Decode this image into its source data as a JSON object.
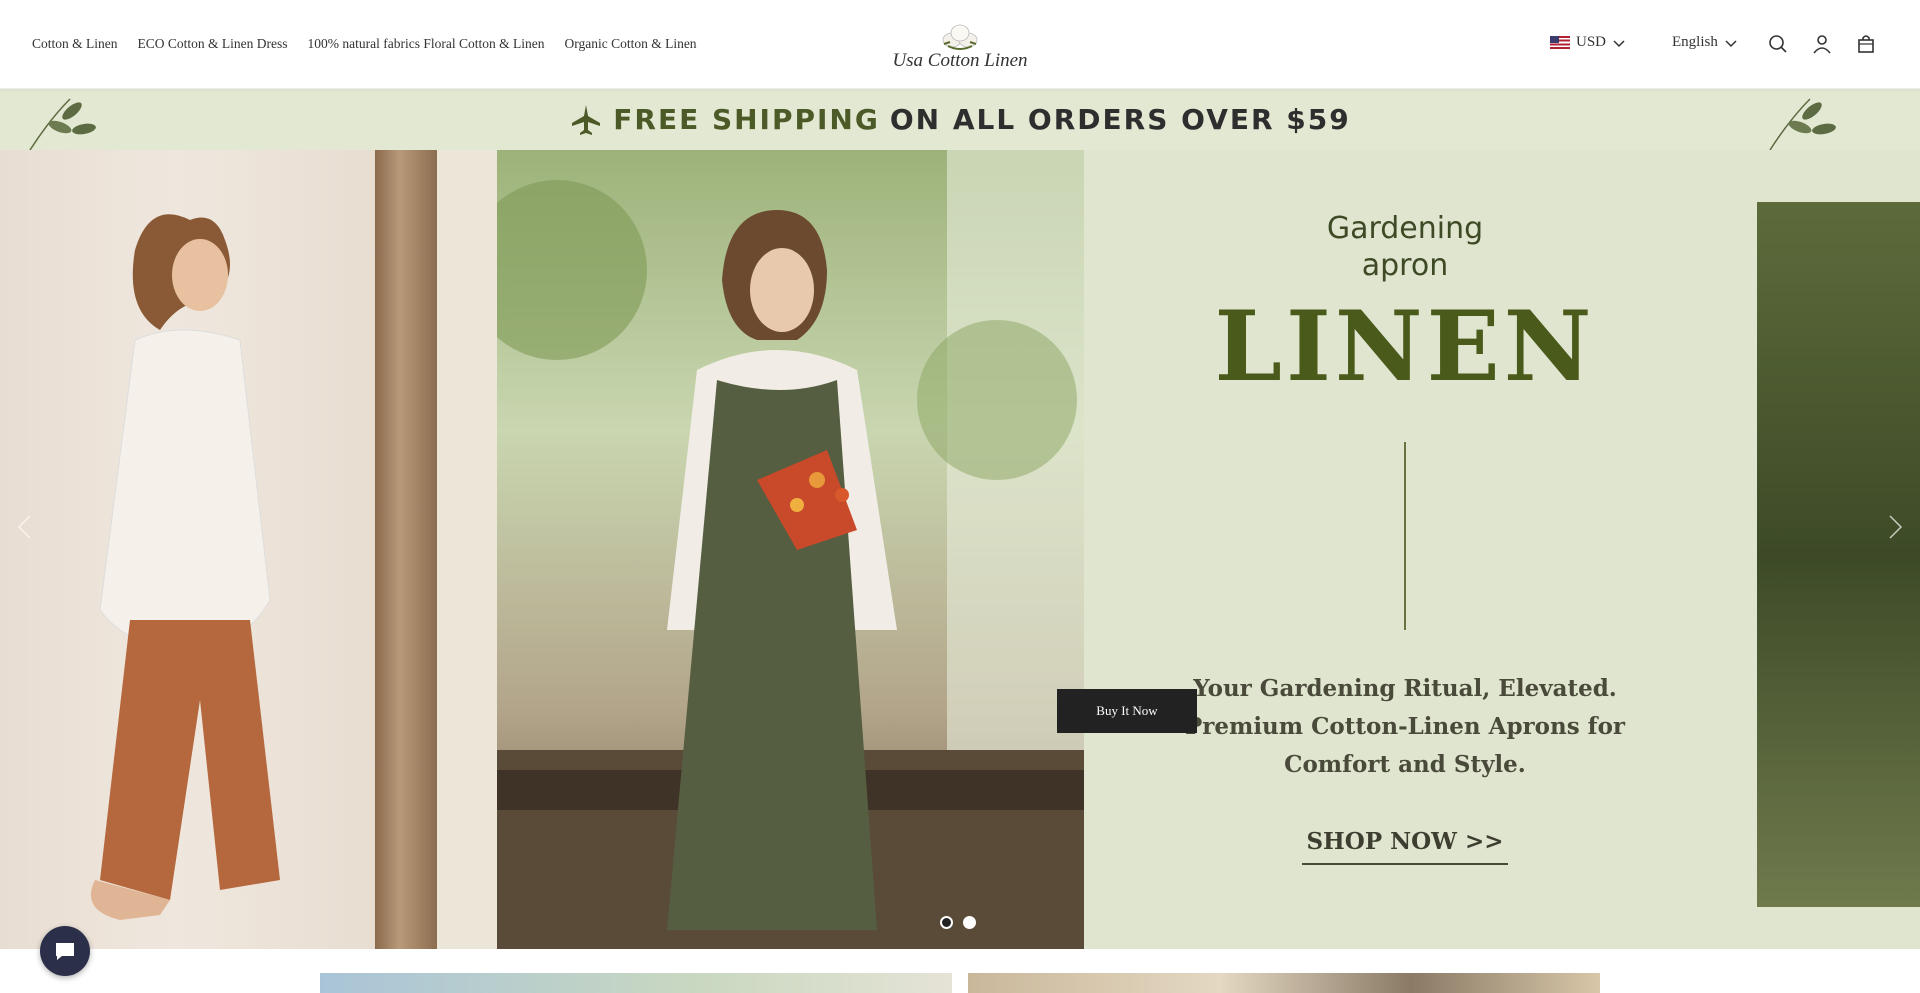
{
  "header": {
    "nav": [
      {
        "label": "Cotton & Linen"
      },
      {
        "label": "ECO Cotton & Linen Dress"
      },
      {
        "label": "100% natural fabrics Floral Cotton & Linen"
      },
      {
        "label": "Organic Cotton & Linen"
      }
    ],
    "logo_text": "Usa Cotton Linen",
    "currency": "USD",
    "language": "English",
    "icons": [
      "search-icon",
      "account-icon",
      "cart-icon"
    ]
  },
  "shipping_banner": {
    "highlight": "FREE SHIPPING",
    "rest": "ON ALL ORDERS OVER $59",
    "icon": "airplane-icon",
    "colors": {
      "background": "#e2e8d2",
      "highlight": "#4b5a27"
    }
  },
  "hero": {
    "heading": "Gardening apron",
    "heading_line1": "Gardening",
    "heading_line2": "apron",
    "big_word": "LINEN",
    "tagline_line1": "Your Gardening Ritual, Elevated.",
    "tagline_line2": "Premium Cotton-Linen Aprons for",
    "tagline_line3": "Comfort and Style.",
    "shop_now": "SHOP NOW >>",
    "buy_button": "Buy It Now",
    "slide_count": 2,
    "active_slide": 2,
    "colors": {
      "panel": "#dfe5cf",
      "linen_text": "#4a5a1a",
      "button": "#222222"
    }
  },
  "chat": {
    "icon": "chat-icon"
  }
}
